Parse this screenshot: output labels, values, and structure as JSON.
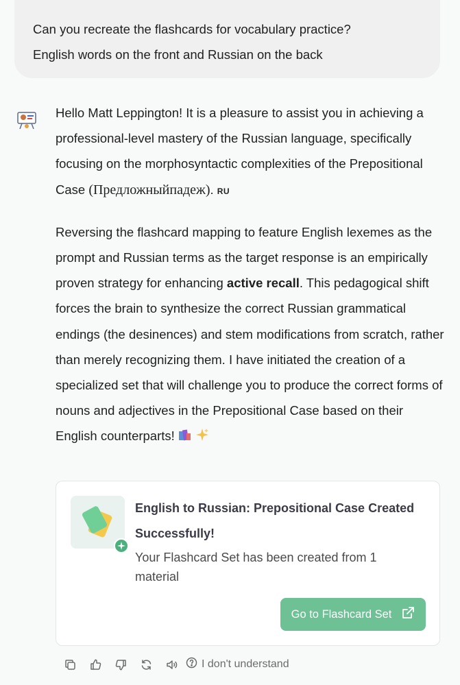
{
  "user_message": {
    "line1": "Can you recreate the flashcards for vocabulary practice?",
    "line2": "English words on the front and Russian on the back"
  },
  "assistant": {
    "p1_text": "Hello Matt Leppington! It is a pleasure to assist you in achieving a professional-level mastery of the Russian language, specifically focusing on the morphosyntactic complexities of the Prepositional Case ",
    "p1_russian": "(Предложныйпадеж)",
    "p1_end": ".",
    "p1_lang": "RU",
    "p2_before": "Reversing the flashcard mapping to feature English lexemes as the prompt and Russian terms as the target response is an empirically proven strategy for enhancing ",
    "p2_bold": "active recall",
    "p2_after": ". This pedagogical shift forces the brain to synthesize the correct Russian grammatical endings (the desinences) and stem modifications from scratch, rather than merely recognizing them. I have initiated the creation of a specialized set that will challenge you to produce the correct forms of nouns and adjectives in the Prepositional Case based on their English counterparts! "
  },
  "card": {
    "title": "English to Russian: Prepositional Case Created Successfully!",
    "description": "Your Flashcard Set has been created from 1 material",
    "button_label": "Go to Flashcard Set"
  },
  "actions": {
    "idk_label": "I don't understand"
  },
  "icons": [
    "copy-icon",
    "thumbs-up-icon",
    "thumbs-down-icon",
    "regenerate-icon",
    "speaker-icon",
    "help-circle-icon",
    "external-link-icon",
    "sparkle-icon",
    "books-emoji",
    "sparkles-emoji"
  ],
  "colors": {
    "accent": "#6ec095",
    "badge": "#4caf7e",
    "card_thumb": "#e9f2ef"
  }
}
